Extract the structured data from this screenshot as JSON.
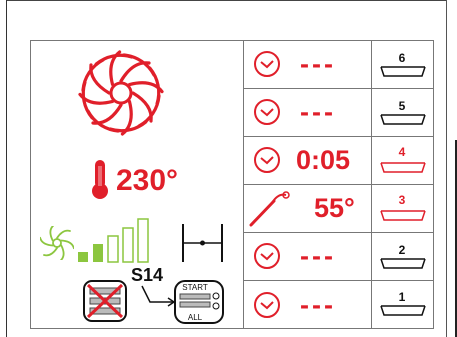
{
  "oven": {
    "temperature": "230°",
    "program": "S14",
    "start_label": "START",
    "all_label": "ALL",
    "fan_power_level": 5,
    "fan_power_max": 5
  },
  "shelves": [
    {
      "number": "6",
      "value": "---",
      "active": false,
      "icon": "timer-icon"
    },
    {
      "number": "5",
      "value": "---",
      "active": false,
      "icon": "timer-icon"
    },
    {
      "number": "4",
      "value": "0:05",
      "active": true,
      "icon": "timer-icon"
    },
    {
      "number": "3",
      "value": "55°",
      "active": true,
      "icon": "core-probe-icon"
    },
    {
      "number": "2",
      "value": "---",
      "active": false,
      "icon": "timer-icon"
    },
    {
      "number": "1",
      "value": "---",
      "active": false,
      "icon": "timer-icon"
    }
  ],
  "colors": {
    "accent_red": "#e01f2a",
    "fan_green": "#8cc63f",
    "line_gray": "#777777"
  }
}
